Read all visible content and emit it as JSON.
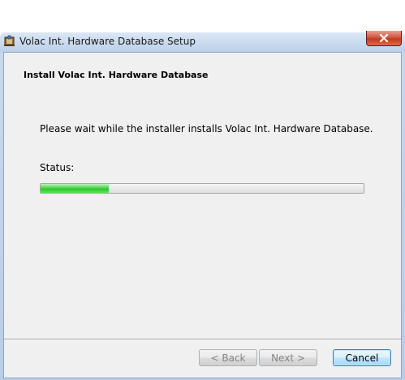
{
  "window": {
    "title": "Volac Int. Hardware Database Setup"
  },
  "banner": {
    "title": "Install Volac Int. Hardware Database"
  },
  "body": {
    "message": "Please wait while the installer installs Volac Int. Hardware Database.",
    "status_label": "Status:",
    "progress_fraction": 0.21
  },
  "buttons": {
    "back": "< Back",
    "next": "Next >",
    "cancel": "Cancel"
  },
  "icons": {
    "app": "installer-icon",
    "close": "close-icon"
  },
  "colors": {
    "progress_green": "#2cc72c",
    "close_red": "#c23a21"
  }
}
